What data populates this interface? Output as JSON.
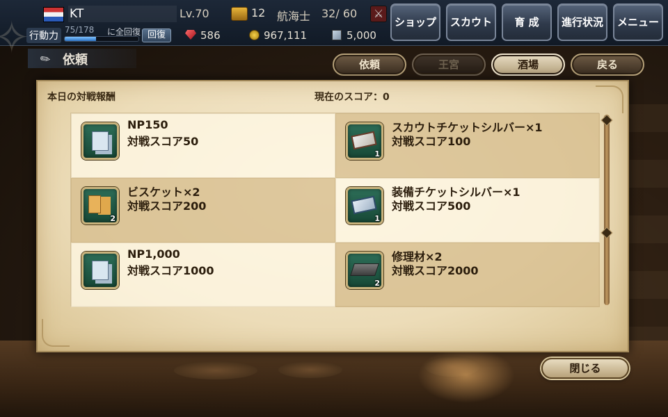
{
  "player": {
    "name": "KT",
    "level": "Lv.70",
    "chest_count": "12",
    "sailor_label": "航海士",
    "sailor_value": "32/ 60"
  },
  "stamina": {
    "label": "行動力",
    "value": "75/178",
    "full_recovery_text": "に全回復",
    "fill_fraction": 0.42,
    "recover_label": "回復"
  },
  "currency": {
    "gems": "586",
    "gold": "967,111",
    "tickets": "5,000"
  },
  "top_menu": {
    "shop": "ショップ",
    "scout": "スカウト",
    "training": "育 成",
    "progress": "進行状況",
    "menu": "メニュー"
  },
  "section": {
    "title": "依頼"
  },
  "tabs": {
    "request": "依頼",
    "palace": "王宮",
    "tavern": "酒場",
    "back": "戻る"
  },
  "panel": {
    "title": "本日の対戦報酬",
    "current_score": "現在のスコア：0",
    "rewards": [
      {
        "name": "NP150",
        "score": "対戦スコア50",
        "qty": "",
        "icon": "np-icon"
      },
      {
        "name": "スカウトチケットシルバー×1",
        "score": "対戦スコア100",
        "qty": "1",
        "icon": "scout-ticket-icon"
      },
      {
        "name": "ビスケット×2",
        "score": "対戦スコア200",
        "qty": "2",
        "icon": "biscuit-icon"
      },
      {
        "name": "装備チケットシルバー×1",
        "score": "対戦スコア500",
        "qty": "1",
        "icon": "equipment-ticket-icon"
      },
      {
        "name": "NP1,000",
        "score": "対戦スコア1000",
        "qty": "",
        "icon": "np-icon"
      },
      {
        "name": "修理材×2",
        "score": "対戦スコア2000",
        "qty": "2",
        "icon": "repair-material-icon"
      }
    ]
  },
  "close_label": "閉じる"
}
